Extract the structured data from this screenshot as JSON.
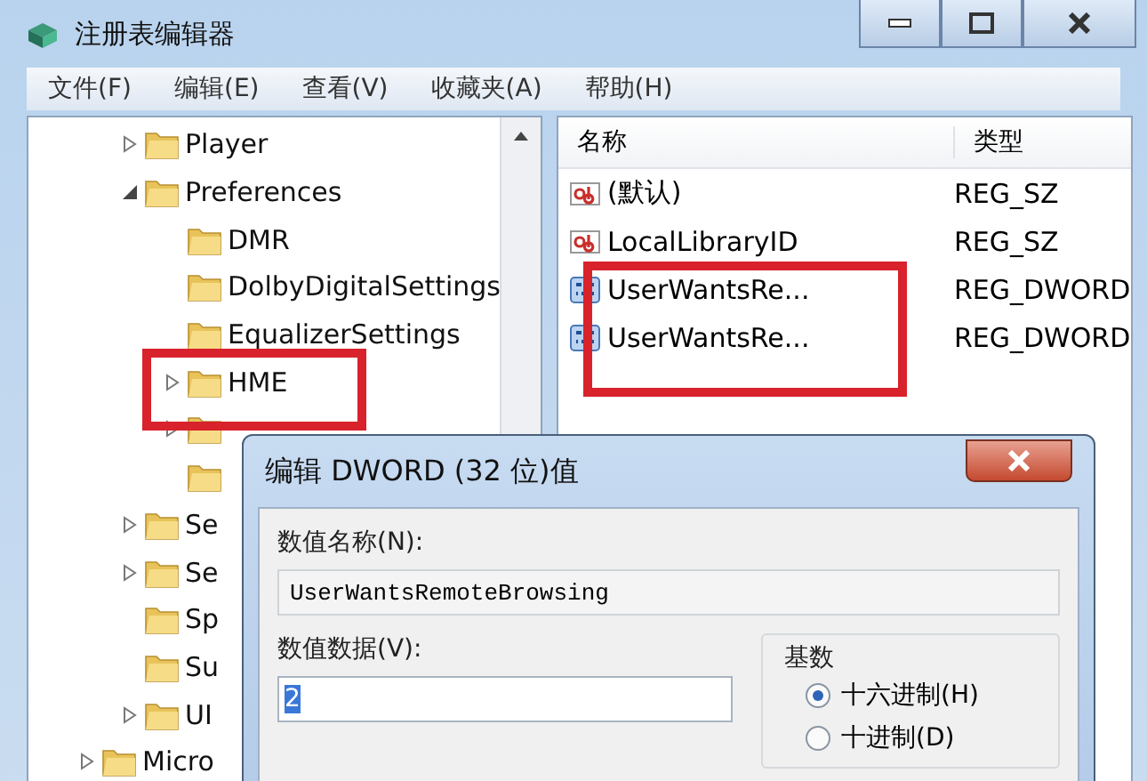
{
  "window": {
    "title": "注册表编辑器"
  },
  "menu": [
    "文件(F)",
    "编辑(E)",
    "查看(V)",
    "收藏夹(A)",
    "帮助(H)"
  ],
  "tree": {
    "items": [
      {
        "children": [
          {
            "kind": "folder",
            "label": "Player",
            "expanded": false
          },
          {
            "kind": "folder",
            "label": "Preferences",
            "expanded": true,
            "children": [
              {
                "kind": "folder",
                "label": "DMR"
              },
              {
                "kind": "folder",
                "label": "DolbyDigitalSettings"
              },
              {
                "kind": "folder",
                "label": "EqualizerSettings"
              },
              {
                "kind": "folder",
                "label": "HME",
                "expanded": false
              },
              {
                "kind": "folder",
                "expanded": false
              },
              {
                "kind": "folder"
              }
            ]
          },
          {
            "kind": "folder",
            "label": "Se",
            "expanded": false
          },
          {
            "kind": "folder",
            "label": "Se",
            "expanded": false
          },
          {
            "kind": "folder",
            "label": "Sp"
          },
          {
            "kind": "folder",
            "label": "Su"
          },
          {
            "kind": "folder",
            "label": "UI",
            "expanded": false
          }
        ]
      },
      {
        "kind": "folder",
        "label": "Micro",
        "expanded": false
      }
    ]
  },
  "values": {
    "columns": [
      "名称",
      "类型"
    ],
    "rows": [
      {
        "kind": "string",
        "name": "(默认)",
        "type": "REG_SZ"
      },
      {
        "kind": "string",
        "name": "LocalLibraryID",
        "type": "REG_SZ"
      },
      {
        "kind": "dword",
        "name": "UserWantsRe...",
        "type": "REG_DWORD"
      },
      {
        "kind": "dword",
        "name": "UserWantsRe...",
        "type": "REG_DWORD"
      }
    ]
  },
  "dialog": {
    "title": "编辑 DWORD (32 位)值",
    "name_label": "数值名称(N):",
    "name_value": "UserWantsRemoteBrowsing",
    "data_label": "数值数据(V):",
    "data_value": "2",
    "base_label": "基数",
    "bases": [
      {
        "label": "十六进制(H)",
        "selected": true
      },
      {
        "label": "十进制(D)",
        "selected": false
      }
    ]
  }
}
